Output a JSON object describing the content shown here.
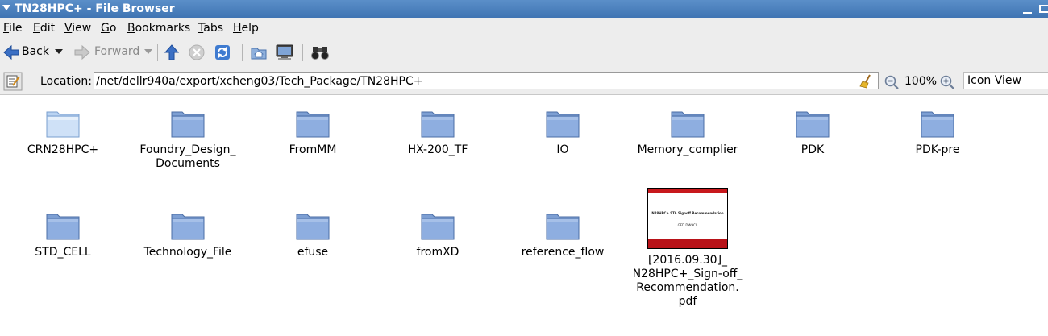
{
  "window": {
    "title": "TN28HPC+ - File Browser"
  },
  "menu": [
    "File",
    "Edit",
    "View",
    "Go",
    "Bookmarks",
    "Tabs",
    "Help"
  ],
  "toolbar": {
    "back_label": "Back",
    "forward_label": "Forward"
  },
  "location": {
    "label": "Location:",
    "path": "/net/dellr940a/export/xcheng03/Tech_Package/TN28HPC+",
    "zoom": "100%",
    "view_mode": "Icon View"
  },
  "items": [
    {
      "name": "CRN28HPC+",
      "type": "folder"
    },
    {
      "name": "Foundry_Design_\nDocuments",
      "type": "folder"
    },
    {
      "name": "FromMM",
      "type": "folder"
    },
    {
      "name": "HX-200_TF",
      "type": "folder"
    },
    {
      "name": "IO",
      "type": "folder"
    },
    {
      "name": "Memory_complier",
      "type": "folder"
    },
    {
      "name": "PDK",
      "type": "folder"
    },
    {
      "name": "PDK-pre",
      "type": "folder"
    },
    {
      "name": "STD_CELL",
      "type": "folder"
    },
    {
      "name": "Technology_File",
      "type": "folder"
    },
    {
      "name": "efuse",
      "type": "folder"
    },
    {
      "name": "fromXD",
      "type": "folder"
    },
    {
      "name": "reference_flow",
      "type": "folder"
    },
    {
      "name": "[2016.09.30]_\nN28HPC+_Sign-off_\nRecommendation.\npdf",
      "type": "pdf",
      "thumb_title": "N28HPC+ STA Signoff Recommendation",
      "thumb_sub": "GFD DW9C0"
    }
  ],
  "colors": {
    "titlebar": "#4a7fbf",
    "folder": "#7d9fd3",
    "thumb_red": "#c8181d"
  }
}
